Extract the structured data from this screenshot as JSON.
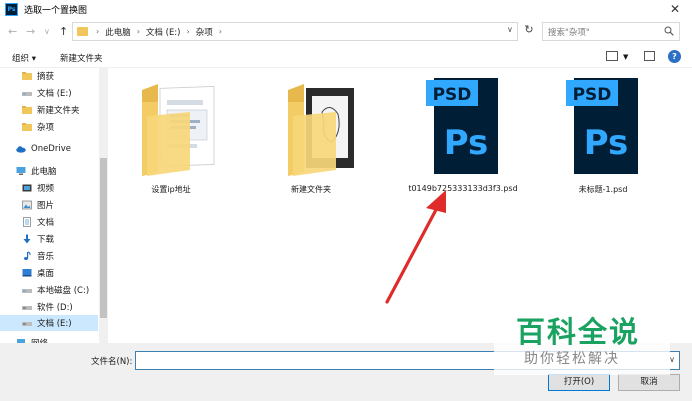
{
  "window": {
    "title": "选取一个置换图",
    "app_icon": "Ps"
  },
  "address": {
    "crumbs": [
      "此电脑",
      "文档 (E:)",
      "杂项"
    ],
    "search_placeholder": "搜索\"杂项\""
  },
  "toolbar": {
    "organize": "组织 ▾",
    "new_folder": "新建文件夹"
  },
  "sidebar": {
    "items": [
      {
        "label": "摘获",
        "icon": "folder-icon"
      },
      {
        "label": "文档 (E:)",
        "icon": "drive-icon"
      },
      {
        "label": "新建文件夹",
        "icon": "folder-icon"
      },
      {
        "label": "杂项",
        "icon": "folder-icon"
      },
      {
        "label": "OneDrive",
        "icon": "cloud-icon"
      },
      {
        "label": "此电脑",
        "icon": "computer-icon"
      },
      {
        "label": "视频",
        "icon": "video-icon"
      },
      {
        "label": "图片",
        "icon": "picture-icon"
      },
      {
        "label": "文档",
        "icon": "document-icon"
      },
      {
        "label": "下载",
        "icon": "download-icon"
      },
      {
        "label": "音乐",
        "icon": "music-icon"
      },
      {
        "label": "桌面",
        "icon": "desktop-icon"
      },
      {
        "label": "本地磁盘 (C:)",
        "icon": "drive-icon"
      },
      {
        "label": "软件 (D:)",
        "icon": "drive-icon"
      },
      {
        "label": "文档 (E:)",
        "icon": "drive-icon"
      },
      {
        "label": "网络",
        "icon": "network-icon"
      }
    ],
    "selected_index": 14
  },
  "files": [
    {
      "name": "设置ip地址",
      "type": "folder"
    },
    {
      "name": "新建文件夹",
      "type": "folder"
    },
    {
      "name": "t0149b725333133d3f3.psd",
      "type": "psd"
    },
    {
      "name": "未标题-1.psd",
      "type": "psd"
    }
  ],
  "psd_icon_text": {
    "badge": "PSD",
    "logo": "Ps"
  },
  "bottom": {
    "filename_label": "文件名(N):",
    "filename_value": "",
    "open_label": "打开(O)",
    "cancel_label": "取消"
  },
  "watermark": {
    "main": "百科全说",
    "sub": "助你轻松解决"
  },
  "colors": {
    "psd_dark": "#001e36",
    "psd_blue": "#31a8ff",
    "folder_yellow": "#f1c75b",
    "arrow_red": "#e02b2b",
    "watermark_green": "#1aa260"
  }
}
